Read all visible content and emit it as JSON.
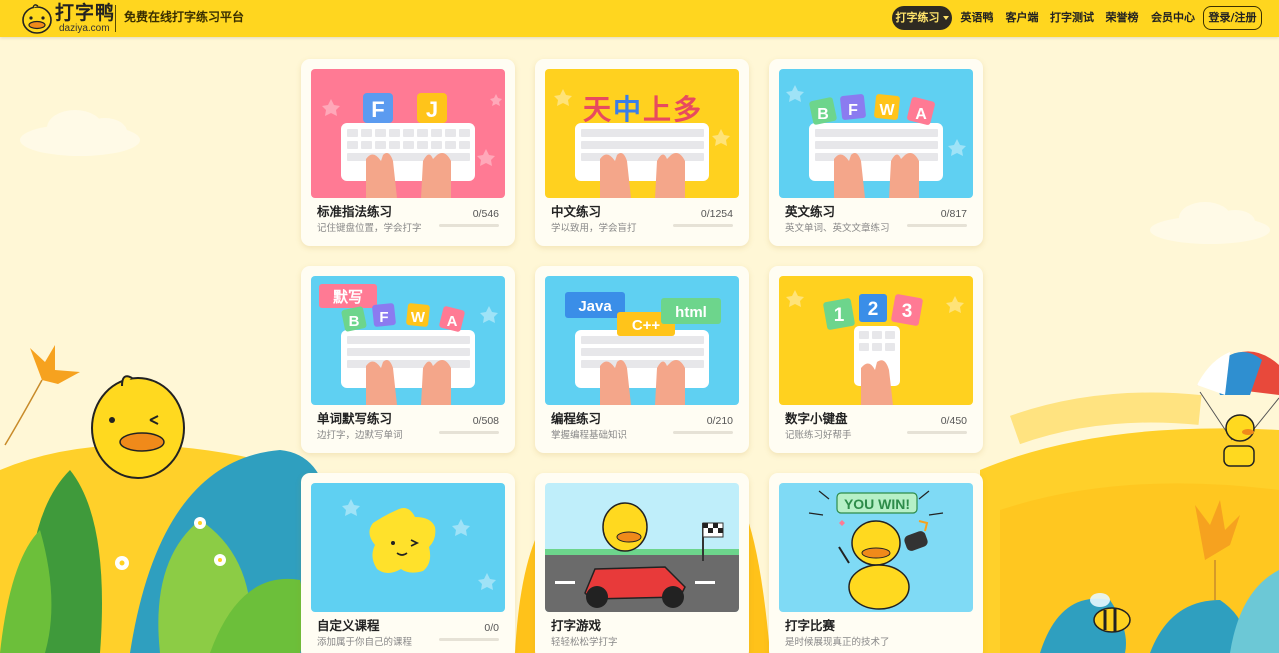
{
  "brand": {
    "name": "打字鸭",
    "domain": "daziya.com",
    "slogan": "免费在线打字练习平台"
  },
  "nav": {
    "items": [
      {
        "label": "打字练习",
        "active": true
      },
      {
        "label": "英语鸭"
      },
      {
        "label": "客户端"
      },
      {
        "label": "打字测试"
      },
      {
        "label": "荣誉榜"
      },
      {
        "label": "会员中心"
      }
    ],
    "login_label": "登录/注册"
  },
  "colors": {
    "header": "#ffd61f",
    "page_bg": "#fff7d6",
    "pink": "#ff7a94",
    "yellow": "#ffd11f",
    "blue": "#5fd0f2",
    "active_nav_bg": "#2e2a22"
  },
  "cards": [
    {
      "title": "标准指法练习",
      "desc": "记住键盘位置，学会打字",
      "count": "0/546",
      "progress": 0,
      "bg": "pink",
      "image_text": [
        "F",
        "J"
      ]
    },
    {
      "title": "中文练习",
      "desc": "学以致用，学会盲打",
      "count": "0/1254",
      "progress": 0,
      "bg": "yellow",
      "image_text": [
        "天",
        "中",
        "上",
        "多"
      ]
    },
    {
      "title": "英文练习",
      "desc": "英文单词、英文文章练习",
      "count": "0/817",
      "progress": 0,
      "bg": "blue",
      "image_text": [
        "B",
        "F",
        "W",
        "A"
      ]
    },
    {
      "title": "单词默写练习",
      "desc": "边打字，边默写单词",
      "count": "0/508",
      "progress": 0,
      "bg": "blue",
      "image_text": [
        "默写",
        "B",
        "F",
        "W",
        "A"
      ]
    },
    {
      "title": "编程练习",
      "desc": "掌握编程基础知识",
      "count": "0/210",
      "progress": 0,
      "bg": "blue",
      "image_text": [
        "Java",
        "C++",
        "html"
      ]
    },
    {
      "title": "数字小键盘",
      "desc": "记账练习好帮手",
      "count": "0/450",
      "progress": 0,
      "bg": "yellow",
      "image_text": [
        "1",
        "2",
        "3"
      ]
    },
    {
      "title": "自定义课程",
      "desc": "添加属于你自己的课程",
      "count": "0/0",
      "progress": 0,
      "bg": "blue",
      "image_text": []
    },
    {
      "title": "打字游戏",
      "desc": "轻轻松松学打字",
      "count": "",
      "progress": 0,
      "bg": "scene",
      "image_text": []
    },
    {
      "title": "打字比赛",
      "desc": "是时候展现真正的技术了",
      "count": "",
      "progress": 0,
      "bg": "blue",
      "image_text": [
        "YOU WIN!"
      ]
    }
  ]
}
